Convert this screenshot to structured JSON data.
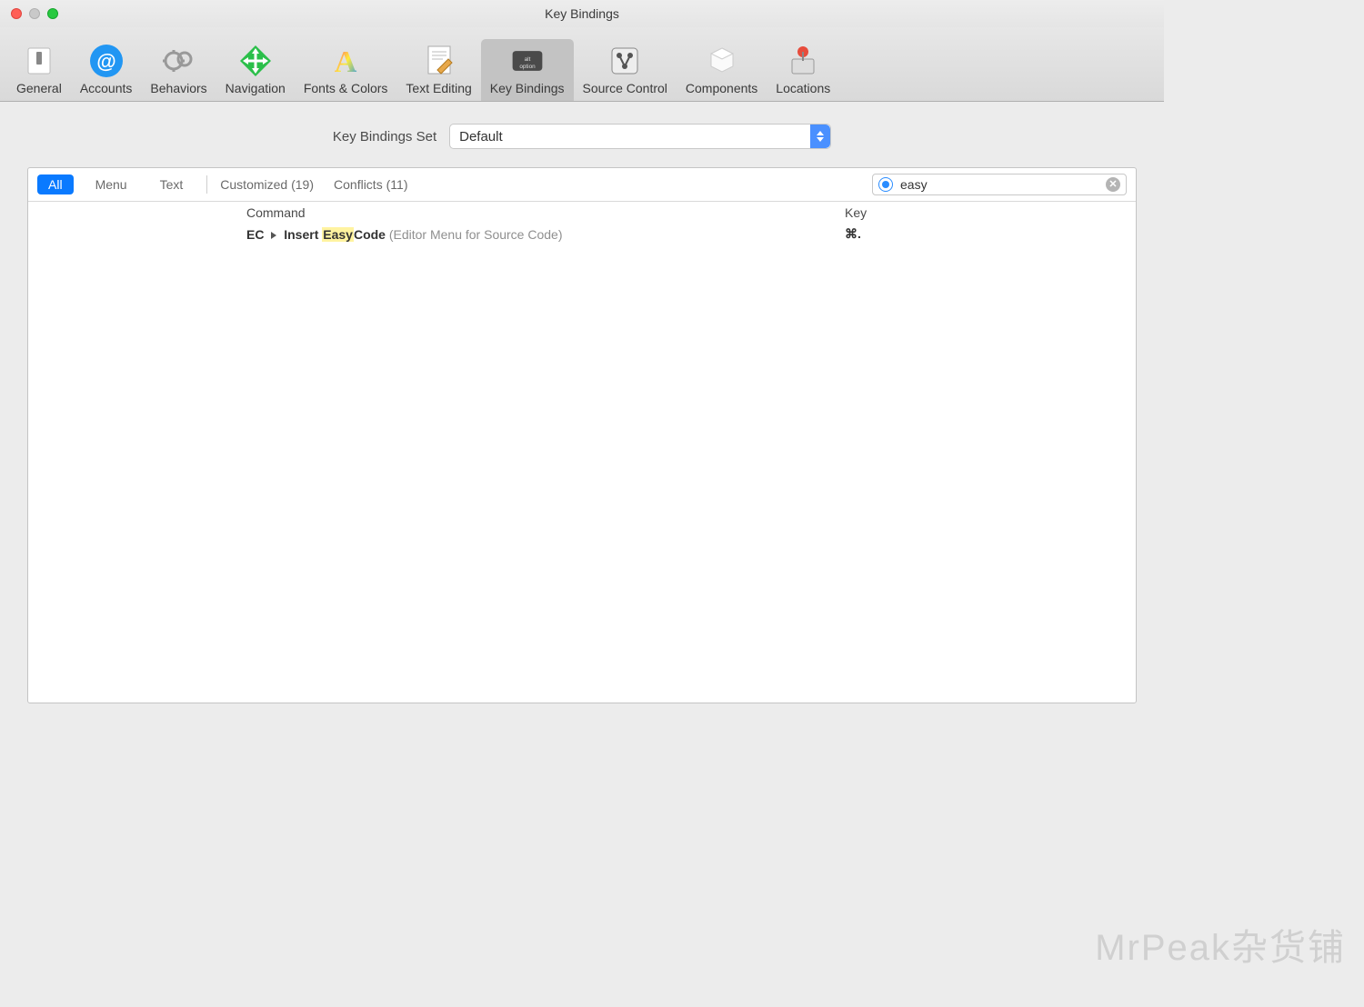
{
  "window": {
    "title": "Key Bindings"
  },
  "toolbar": {
    "items": [
      {
        "label": "General"
      },
      {
        "label": "Accounts"
      },
      {
        "label": "Behaviors"
      },
      {
        "label": "Navigation"
      },
      {
        "label": "Fonts & Colors"
      },
      {
        "label": "Text Editing"
      },
      {
        "label": "Key Bindings"
      },
      {
        "label": "Source Control"
      },
      {
        "label": "Components"
      },
      {
        "label": "Locations"
      }
    ],
    "selected_index": 6
  },
  "set_selector": {
    "label": "Key Bindings Set",
    "value": "Default"
  },
  "filters": {
    "segments": [
      "All",
      "Menu",
      "Text"
    ],
    "active_segment": 0,
    "customized": {
      "label": "Customized",
      "count": 19
    },
    "conflicts": {
      "label": "Conflicts",
      "count": 11
    }
  },
  "search": {
    "value": "easy"
  },
  "table": {
    "headers": {
      "command": "Command",
      "key": "Key"
    },
    "rows": [
      {
        "prefix": "EC",
        "action_pre": "Insert ",
        "highlight": "Easy",
        "action_post": "Code",
        "context": " (Editor Menu for Source Code)",
        "key": "⌘."
      }
    ]
  },
  "watermark": "MrPeak杂货铺"
}
